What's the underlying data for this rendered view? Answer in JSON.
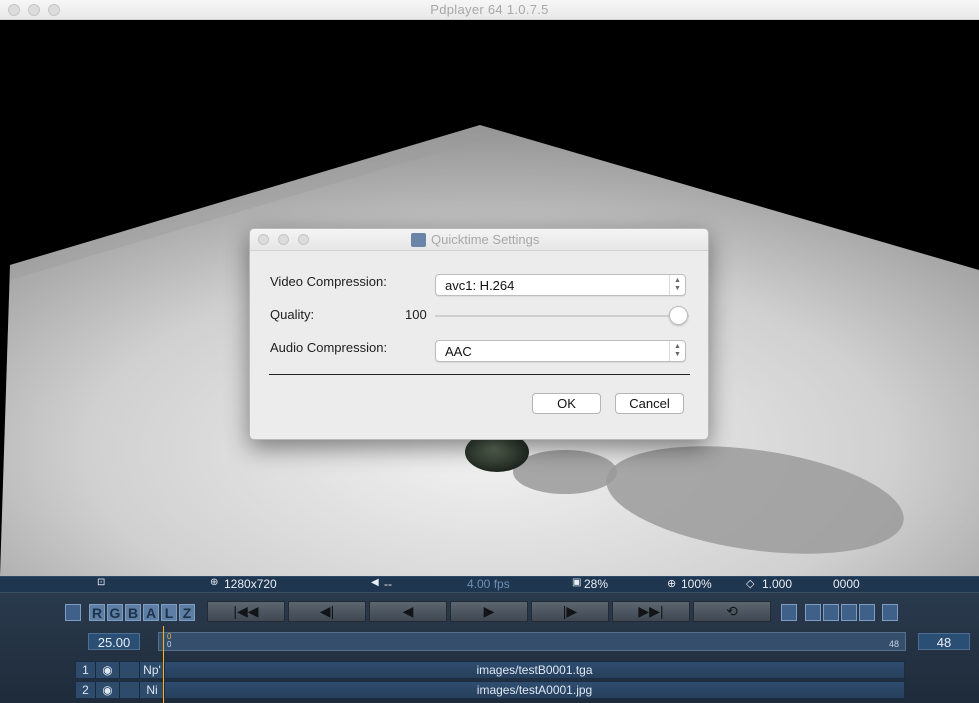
{
  "window": {
    "title": "Pdplayer 64 1.0.7.5"
  },
  "dialog": {
    "title": "Quicktime Settings",
    "video_compression_label": "Video Compression:",
    "video_compression_value": "avc1: H.264",
    "quality_label": "Quality:",
    "quality_value": "100",
    "quality_level": 1.0,
    "audio_compression_label": "Audio Compression:",
    "audio_compression_value": "AAC",
    "ok_label": "OK",
    "cancel_label": "Cancel"
  },
  "infobar": {
    "resolution": "1280x720",
    "volume": "--",
    "fps": "4.00 fps",
    "cache": "28%",
    "zoom": "100%",
    "aspect": "1.000",
    "frame": "0000"
  },
  "controls": {
    "channels": [
      "R",
      "G",
      "B",
      "A",
      "L",
      "Z"
    ],
    "fps_value": "25.00",
    "end_frame": "48",
    "timeline_start": "0",
    "timeline_end": "48"
  },
  "layers": [
    {
      "index": "1",
      "mode": "Np'",
      "file": "images/testB0001.tga"
    },
    {
      "index": "2",
      "mode": "Ni",
      "file": "images/testA0001.jpg"
    }
  ],
  "colors": {
    "panel_bg": "#1e2b3a",
    "infobar_bg": "#1f3650",
    "playhead": "#ffb21a",
    "dialog_bg": "#ececec"
  },
  "icons": [
    "info-icon",
    "resolution-icon",
    "volume-icon",
    "cache-icon",
    "zoom-icon",
    "aspect-icon",
    "eye-icon",
    "loop-icon"
  ]
}
